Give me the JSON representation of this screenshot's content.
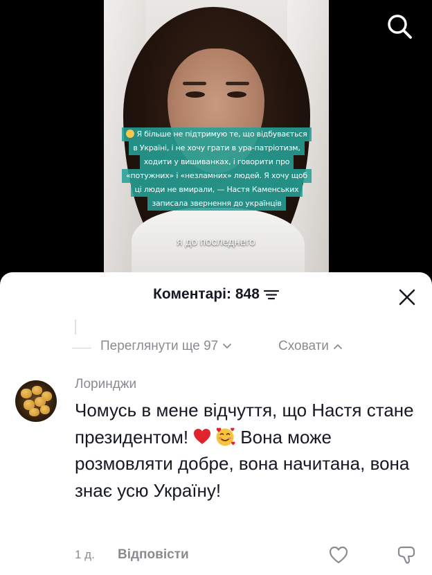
{
  "video": {
    "caption_lines": [
      "Я більше не підтримую те, що відбувається",
      "в Україні, і не хочу грати в ура-патріотизм,",
      "ходити у вишиванках, і говорити про",
      "«потужних» і «незламних» людей. Я хочу щоб",
      "ці люди не вмирали, — Настя Каменських",
      "записала звернення до українців"
    ],
    "subtitle": "я до последнего"
  },
  "comments": {
    "title": "Коментарі: 848",
    "view_more": "Переглянути ще 97",
    "hide": "Сховати",
    "items": [
      {
        "author": "Лоринджи",
        "text_before_emoji": "Чомусь в мене відчуття, що Настя стане президентом!",
        "text_after_emoji": "Вона може розмовляти добре, вона начитана, вона знає усю Україну!",
        "time": "1 д.",
        "reply_label": "Відповісти"
      }
    ]
  },
  "icons": {
    "search": "search-icon",
    "sort": "sort-icon",
    "close": "close-icon",
    "heart": "heart-icon",
    "dislike": "dislike-icon"
  },
  "colors": {
    "caption_bg": "#26a096",
    "text_primary": "#161823",
    "text_secondary": "#8a8b91",
    "heart_red": "#e0242e"
  }
}
